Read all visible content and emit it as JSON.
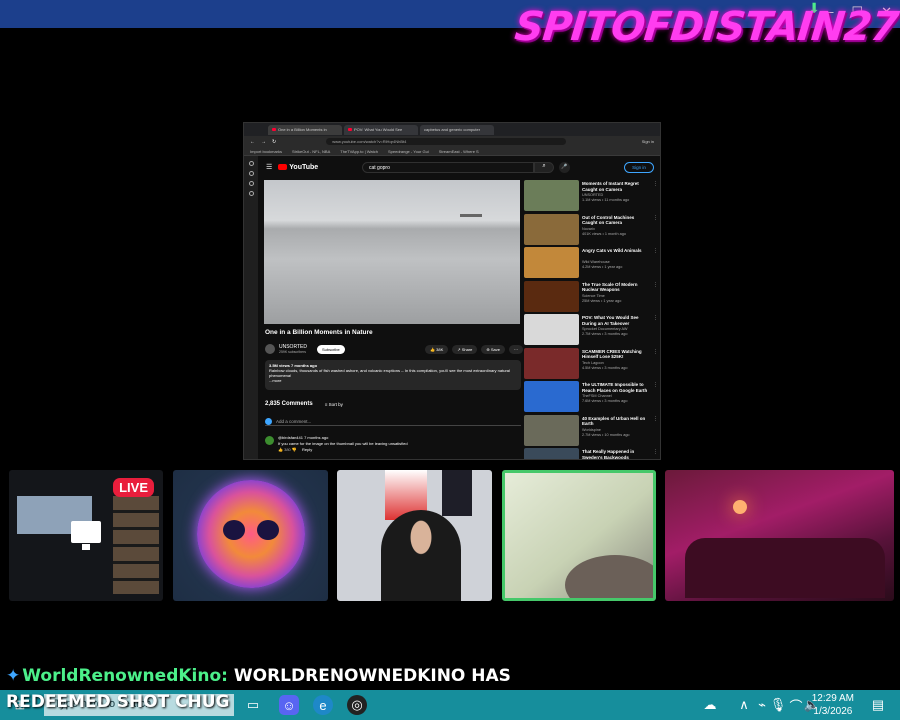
{
  "overlay": {
    "brand_text": "SPITOFDISTAIN27",
    "live_badge": "LIVE",
    "chat_icon": "sparkle-icon",
    "chat_user": "WorldRenownedKino:",
    "chat_line1": "WORLDRENOWNEDKINO HAS",
    "chat_line2": "REDEEMED SHOT CHUG"
  },
  "browser": {
    "tabs": [
      {
        "label": "One in a Billion Moments in"
      },
      {
        "label": "POV: What You Would See"
      },
      {
        "label": "capbetus and generic computer"
      }
    ],
    "url": "www.youtube.com/watch?v=RlHqr4NhBt4",
    "sign_in_label": "Sign in",
    "bookmarks": [
      "Import bookmarks",
      "StrikeOut - NFL, NBA",
      "TheTVApp.to | Watch",
      "Speedrange - Your Gui",
      "StreamEast - Where S"
    ]
  },
  "youtube": {
    "logo_text": "YouTube",
    "search_value": "cat gopro",
    "sign_in_label": "Sign in",
    "video_title": "One in a Billion Moments in Nature",
    "channel_name": "UNSORTED",
    "channel_subs": "259K subscribers",
    "subscribe_label": "Subscribe",
    "likes": "38K",
    "share_label": "Share",
    "save_label": "Save",
    "desc_meta": "3.5M views  7 months ago",
    "desc_text": "Rainbow clouds, thousands of fish washed ashore, and volcanic eruptions -- In this compilation, you'll see the most extraordinary natural phenomena!",
    "desc_more": "...more",
    "comments_count": "2,835 Comments",
    "sort_label": "Sort by",
    "add_comment_placeholder": "Add a comment...",
    "comment_author": "@birdsfan441  7 months ago",
    "comment_text": "If you came for the image on the thumbnail you will be leaving unsatisfied",
    "comment_likes": "380",
    "reply_label": "Reply",
    "related": [
      {
        "title": "Moments of Instant Regret Caught on Camera",
        "channel": "UNSORTED",
        "meta": "1.1M views • 11 months ago",
        "color": "#6b7d59"
      },
      {
        "title": "Out of Control Machines Caught on Camera",
        "channel": "Novarix",
        "meta": "401K views • 1 month ago",
        "color": "#8a6a3a"
      },
      {
        "title": "Angry Cats vs Wild Animals",
        "channel": "Wild Warehouse",
        "meta": "4.2M views • 1 year ago",
        "color": "#c2883a"
      },
      {
        "title": "The True Scale Of Modern Nuclear Weapons",
        "channel": "Science Time",
        "meta": "25M views • 1 year ago",
        "color": "#5a2a10"
      },
      {
        "title": "POV: What You Would See During an AI Takeover",
        "channel": "Sprocket Documentary AW",
        "meta": "2.7M views • 3 months ago",
        "color": "#d9d9d9"
      },
      {
        "title": "SCAMMER CRIES Watching Himself Lose $25K!",
        "channel": "Tech Lagoon",
        "meta": "4.5M views • 3 months ago",
        "color": "#7a2a2a"
      },
      {
        "title": "The ULTIMATE Impossible to Reach Places on Google Earth",
        "channel": "TheFSM Channel",
        "meta": "7.6M views • 3 months ago",
        "color": "#2a6ad0"
      },
      {
        "title": "40 Examples of Urban Hell on Earth",
        "channel": "Worldspine",
        "meta": "2.7M views • 10 months ago",
        "color": "#6a6a5a"
      },
      {
        "title": "That Really Happened in Sweden's Backwoods",
        "channel": "",
        "meta": "",
        "color": "#3a4a5a"
      }
    ]
  },
  "taskbar": {
    "search_placeholder": "Type here to search",
    "time": "12:29 AM",
    "date": "1/3/2026"
  }
}
